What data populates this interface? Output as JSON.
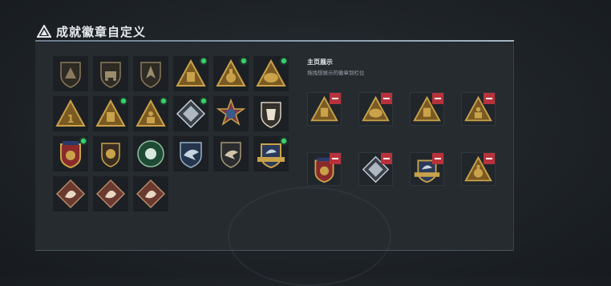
{
  "header": {
    "title": "成就徽章自定义"
  },
  "showcase": {
    "title": "主页展示",
    "subtitle": "拖拽想展示的徽章到栏位",
    "slots": [
      {
        "badge": "tri-tower-badge-icon"
      },
      {
        "badge": "tri-vehicle-badge-icon"
      },
      {
        "badge": "tri-chest-badge-icon"
      },
      {
        "badge": "tri-soldier-badge-icon"
      },
      {
        "badge": "crest-red-badge-icon"
      },
      {
        "badge": "diamond-badge-icon"
      },
      {
        "badge": "wing-crest-badge-icon"
      },
      {
        "badge": "tri-gear-badge-icon"
      }
    ]
  },
  "badges": [
    {
      "icon": "shield-delta-badge-icon",
      "isNew": false
    },
    {
      "icon": "shield-vehicle-badge-icon",
      "isNew": false
    },
    {
      "icon": "shield-jet-badge-icon",
      "isNew": false
    },
    {
      "icon": "tri-tower-badge-icon",
      "isNew": true
    },
    {
      "icon": "tri-gear-badge-icon",
      "isNew": true
    },
    {
      "icon": "tri-vehicle-badge-icon",
      "isNew": true
    },
    {
      "icon": "tri-number-one-badge-icon",
      "isNew": false
    },
    {
      "icon": "tri-chest-badge-icon",
      "isNew": true
    },
    {
      "icon": "tri-soldier-badge-icon",
      "isNew": true
    },
    {
      "icon": "diamond-badge-icon",
      "isNew": true
    },
    {
      "icon": "star-crest-badge-icon",
      "isNew": false
    },
    {
      "icon": "shield-armor-badge-icon",
      "isNew": false
    },
    {
      "icon": "crest-red-badge-icon",
      "isNew": true
    },
    {
      "icon": "shield-lion-badge-icon",
      "isNew": false
    },
    {
      "icon": "wreath-green-badge-icon",
      "isNew": false
    },
    {
      "icon": "shield-blue-eagle-badge-icon",
      "isNew": false
    },
    {
      "icon": "shield-eagle-badge-icon",
      "isNew": false
    },
    {
      "icon": "wing-crest-badge-icon",
      "isNew": true
    },
    {
      "icon": "diamond-beast-badge-icon",
      "isNew": false
    },
    {
      "icon": "diamond-dragon-badge-icon",
      "isNew": false
    },
    {
      "icon": "diamond-runner-badge-icon",
      "isNew": false
    }
  ],
  "colors": {
    "gold": "#c9a24a",
    "gold_dark": "#7a5a22",
    "new_dot": "#3ad36a",
    "remove": "#b8323b"
  }
}
